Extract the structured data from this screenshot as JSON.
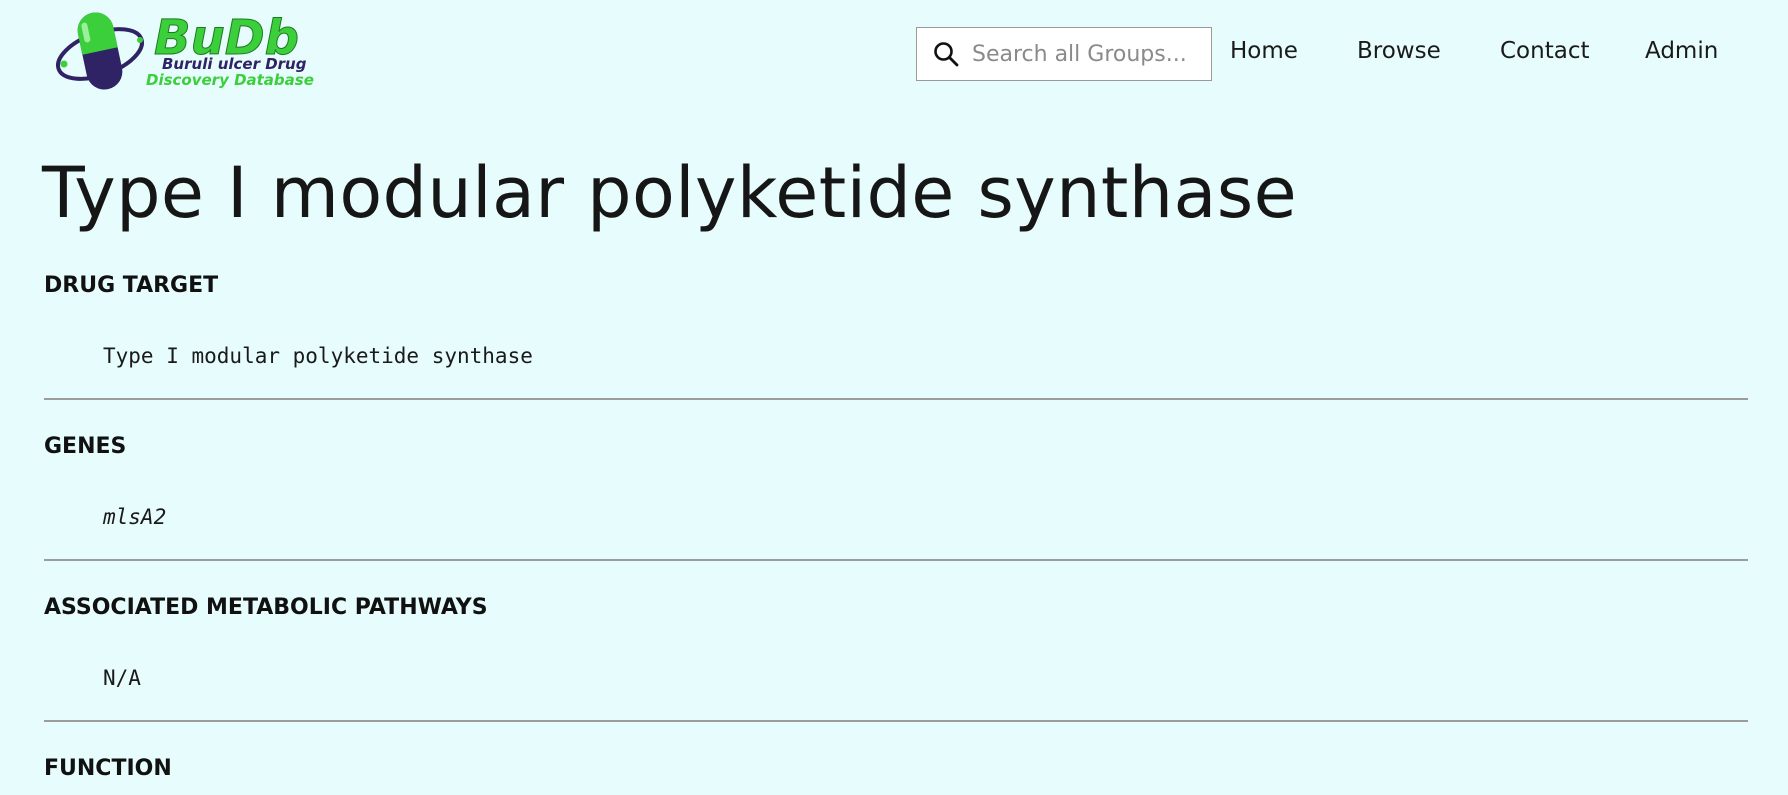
{
  "header": {
    "logo": {
      "name": "BuDb",
      "line1": "Buruli ulcer Drug",
      "line2": "Discovery Database"
    },
    "search": {
      "placeholder": "Search all Groups..."
    },
    "nav": [
      {
        "label": "Home"
      },
      {
        "label": "Browse"
      },
      {
        "label": "Contact"
      },
      {
        "label": "Admin"
      }
    ]
  },
  "main": {
    "title": "Type I modular polyketide synthase",
    "sections": [
      {
        "heading": "DRUG TARGET",
        "value": "Type I modular polyketide synthase"
      },
      {
        "heading": "GENES",
        "value": "mlsA2"
      },
      {
        "heading": "ASSOCIATED METABOLIC PATHWAYS",
        "value": "N/A"
      },
      {
        "heading": "FUNCTION",
        "value": ""
      }
    ]
  },
  "colors": {
    "background": "#e7fcfc",
    "brand_green": "#3ccf3c",
    "brand_purple": "#2f2366",
    "divider": "#9c9c9c"
  }
}
